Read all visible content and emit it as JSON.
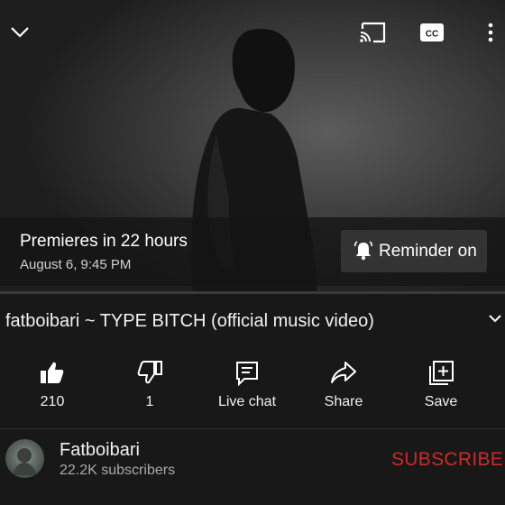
{
  "player": {
    "premiere_title": "Premieres in 22 hours",
    "premiere_date": "August 6, 9:45 PM",
    "reminder_label": "Reminder on",
    "icons": [
      "chevron-down-icon",
      "cast-icon",
      "closed-captions-icon",
      "more-vert-icon",
      "bell-icon"
    ]
  },
  "video": {
    "title": "fatboibari ~ TYPE BITCH (official music video)"
  },
  "actions": [
    {
      "label": "210",
      "icon": "thumbs-up-icon"
    },
    {
      "label": "1",
      "icon": "thumbs-down-icon"
    },
    {
      "label": "Live chat",
      "icon": "live-chat-icon"
    },
    {
      "label": "Share",
      "icon": "share-icon"
    },
    {
      "label": "Save",
      "icon": "save-to-playlist-icon"
    }
  ],
  "channel": {
    "name": "Fatboibari",
    "subscribers": "22.2K subscribers",
    "subscribe_label": "SUBSCRIBE"
  },
  "colors": {
    "background": "#181818",
    "subscribe": "#cc2a2a",
    "reminder_button": "#333333"
  }
}
